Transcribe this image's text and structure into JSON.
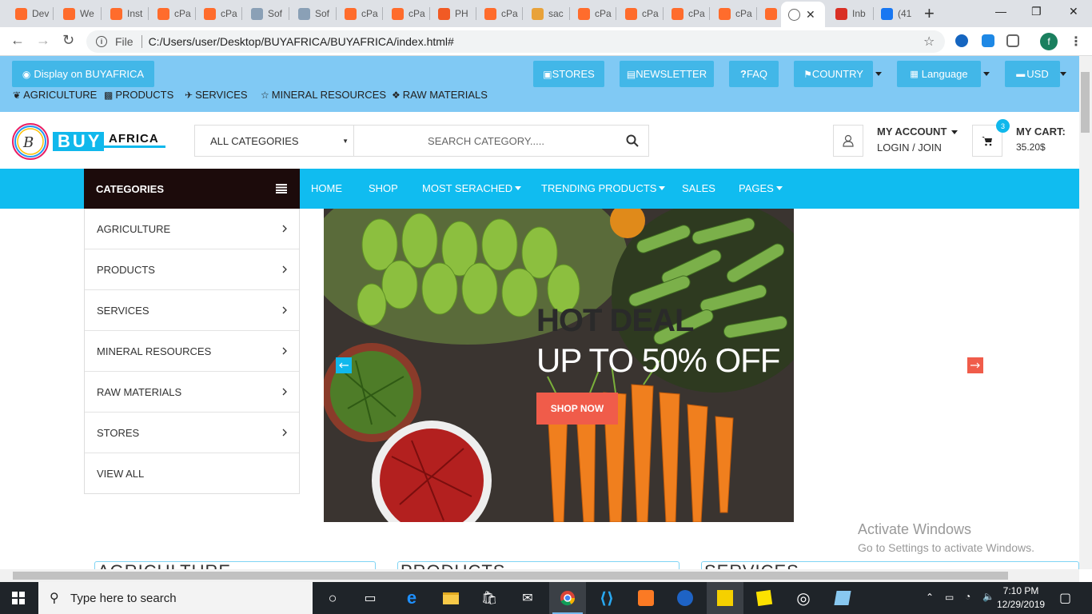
{
  "browser": {
    "tabs": [
      {
        "label": "Dev",
        "icon": "cpanel-icon",
        "color": "#ff6c2c"
      },
      {
        "label": "We",
        "icon": "cpanel-icon",
        "color": "#ff6c2c"
      },
      {
        "label": "Inst",
        "icon": "cpanel-icon",
        "color": "#ff6c2c"
      },
      {
        "label": "cPa",
        "icon": "cpanel-icon",
        "color": "#ff6c2c"
      },
      {
        "label": "cPa",
        "icon": "cpanel-icon",
        "color": "#ff6c2c"
      },
      {
        "label": "Sof",
        "icon": "softaculous-icon",
        "color": "#8aa0b6"
      },
      {
        "label": "Sof",
        "icon": "softaculous-icon",
        "color": "#8aa0b6"
      },
      {
        "label": "cPa",
        "icon": "cpanel-icon",
        "color": "#ff6c2c"
      },
      {
        "label": "cPa",
        "icon": "cpanel-icon",
        "color": "#ff6c2c"
      },
      {
        "label": "PH",
        "icon": "phpmyadmin-icon",
        "color": "#f15a24"
      },
      {
        "label": "cPa",
        "icon": "cpanel-icon",
        "color": "#ff6c2c"
      },
      {
        "label": "sac",
        "icon": "pma-icon",
        "color": "#e8a23a"
      },
      {
        "label": "cPa",
        "icon": "cpanel-icon",
        "color": "#ff6c2c"
      },
      {
        "label": "cPa",
        "icon": "cpanel-icon",
        "color": "#ff6c2c"
      },
      {
        "label": "cPa",
        "icon": "cpanel-icon",
        "color": "#ff6c2c"
      },
      {
        "label": "cPa",
        "icon": "cpanel-icon",
        "color": "#ff6c2c"
      },
      {
        "label": "cPa",
        "icon": "cpanel-icon",
        "color": "#ff6c2c"
      },
      {
        "label": "",
        "icon": "globe-icon",
        "color": "#666666",
        "active": true
      },
      {
        "label": "Inb",
        "icon": "gmail-icon",
        "color": "#d93025"
      },
      {
        "label": "(41",
        "icon": "facebook-icon",
        "color": "#1877f2"
      }
    ],
    "file_label": "File",
    "url": "C:/Users/user/Desktop/BUYAFRICA/BUYAFRICA/index.html#",
    "profile_initial": "f"
  },
  "topbar": {
    "display_btn": "Display on BUYAFRICA",
    "stores": "STORES",
    "newsletter": "NEWSLETTER",
    "faq": "FAQ",
    "country": "COUNTRY",
    "language": "Language",
    "currency": "USD",
    "links": [
      "AGRICULTURE",
      "PRODUCTS",
      "SERVICES",
      "MINERAL RESOURCES",
      "RAW MATERIALS"
    ]
  },
  "header": {
    "logo_text_1": "BUY",
    "logo_text_2": "AFRICA",
    "category_select": "ALL CATEGORIES",
    "search_placeholder": "SEARCH CATEGORY.....",
    "account_title": "MY ACCOUNT",
    "account_login": "LOGIN / JOIN",
    "cart_count": "3",
    "cart_title": "MY CART:",
    "cart_total": "35.20$"
  },
  "nav": {
    "categories_label": "CATEGORIES",
    "items": [
      "HOME",
      "SHOP",
      "MOST SERACHED",
      "TRENDING PRODUCTS",
      "SALES",
      "PAGES"
    ]
  },
  "sidebar": {
    "items": [
      "AGRICULTURE",
      "PRODUCTS",
      "SERVICES",
      "MINERAL RESOURCES",
      "RAW MATERIALS",
      "STORES",
      "VIEW ALL"
    ]
  },
  "hero": {
    "title": "HOT DEAL",
    "subtitle": "UP TO 50% OFF",
    "cta": "SHOP NOW"
  },
  "sections": [
    "AGRICULTURE",
    "PRODUCTS",
    "SERVICES"
  ],
  "watermark": {
    "line1": "Activate Windows",
    "line2": "Go to Settings to activate Windows."
  },
  "taskbar": {
    "search_placeholder": "Type here to search",
    "time": "7:10 PM",
    "date": "12/29/2019"
  },
  "colors": {
    "topbar_bg": "#80c9f4",
    "topbar_btn": "#42b7e8",
    "nav_bg": "#10bcf0",
    "cat_head": "#1c0b0b",
    "cta": "#f05c4a"
  }
}
